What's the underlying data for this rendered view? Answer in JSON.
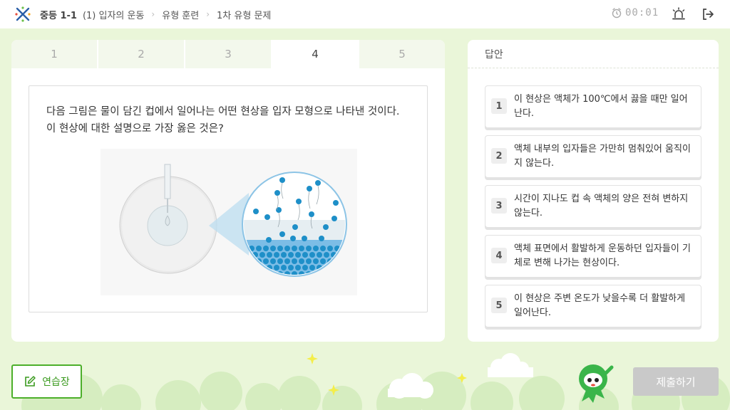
{
  "header": {
    "grade": "중등 1-1",
    "breadcrumbs": [
      "(1) 입자의 운동",
      "유형 훈련",
      "1차 유형 문제"
    ],
    "timer": "00:01"
  },
  "tabs": [
    {
      "label": "1"
    },
    {
      "label": "2"
    },
    {
      "label": "3"
    },
    {
      "label": "4",
      "active": true
    },
    {
      "label": "5"
    }
  ],
  "question": {
    "line1": "다음 그림은 물이 담긴 컵에서 일어나는 어떤 현상을 입자 모형으로 나타낸 것이다.",
    "line2": "이 현상에 대한 설명으로 가장 옳은 것은?"
  },
  "answer_panel": {
    "heading": "답안",
    "choices": [
      {
        "num": "1",
        "text": "이 현상은 액체가 100℃에서 끓을 때만 일어난다."
      },
      {
        "num": "2",
        "text": "액체 내부의 입자들은 가만히 멈춰있어 움직이지 않는다."
      },
      {
        "num": "3",
        "text": "시간이 지나도 컵 속 액체의 양은 전혀 변하지 않는다."
      },
      {
        "num": "4",
        "text": "액체 표면에서 활발하게 운동하던 입자들이 기체로 변해 나가는 현상이다."
      },
      {
        "num": "5",
        "text": "이 현상은 주변 온도가 낮을수록 더 활발하게 일어난다."
      }
    ]
  },
  "buttons": {
    "practice": "연습장",
    "submit": "제출하기"
  },
  "colors": {
    "background": "#eaf6d9",
    "accent_green": "#4caf2a",
    "submit_disabled": "#c9c9c9",
    "particle_blue": "#1e8fc8"
  },
  "icons": [
    "logo-icon",
    "chevron-right-icon",
    "clock-icon",
    "alarm-icon",
    "exit-icon",
    "pencil-note-icon",
    "mascot-icon"
  ]
}
